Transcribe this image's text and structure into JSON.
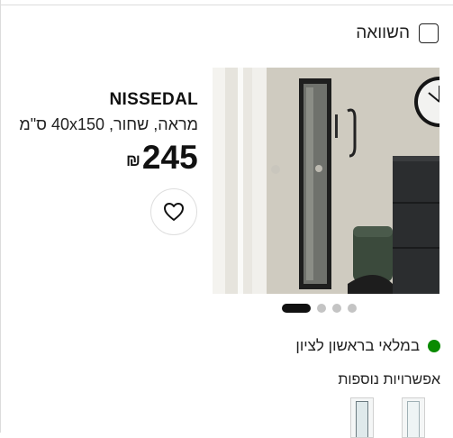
{
  "compare": {
    "label": "השוואה"
  },
  "product": {
    "name": "NISSEDAL",
    "description": "מראה, שחור, 40x150 ס\"מ",
    "price": "245",
    "currency": "₪"
  },
  "image": {
    "slide_count": 4,
    "active_slide": 1
  },
  "stock": {
    "label": "במלאי בראשון לציון",
    "status_color": "#0a8a00"
  },
  "more_options": {
    "label": "אפשרויות נוספות"
  },
  "icons": {
    "favorite": "heart-icon",
    "compare": "checkbox"
  }
}
